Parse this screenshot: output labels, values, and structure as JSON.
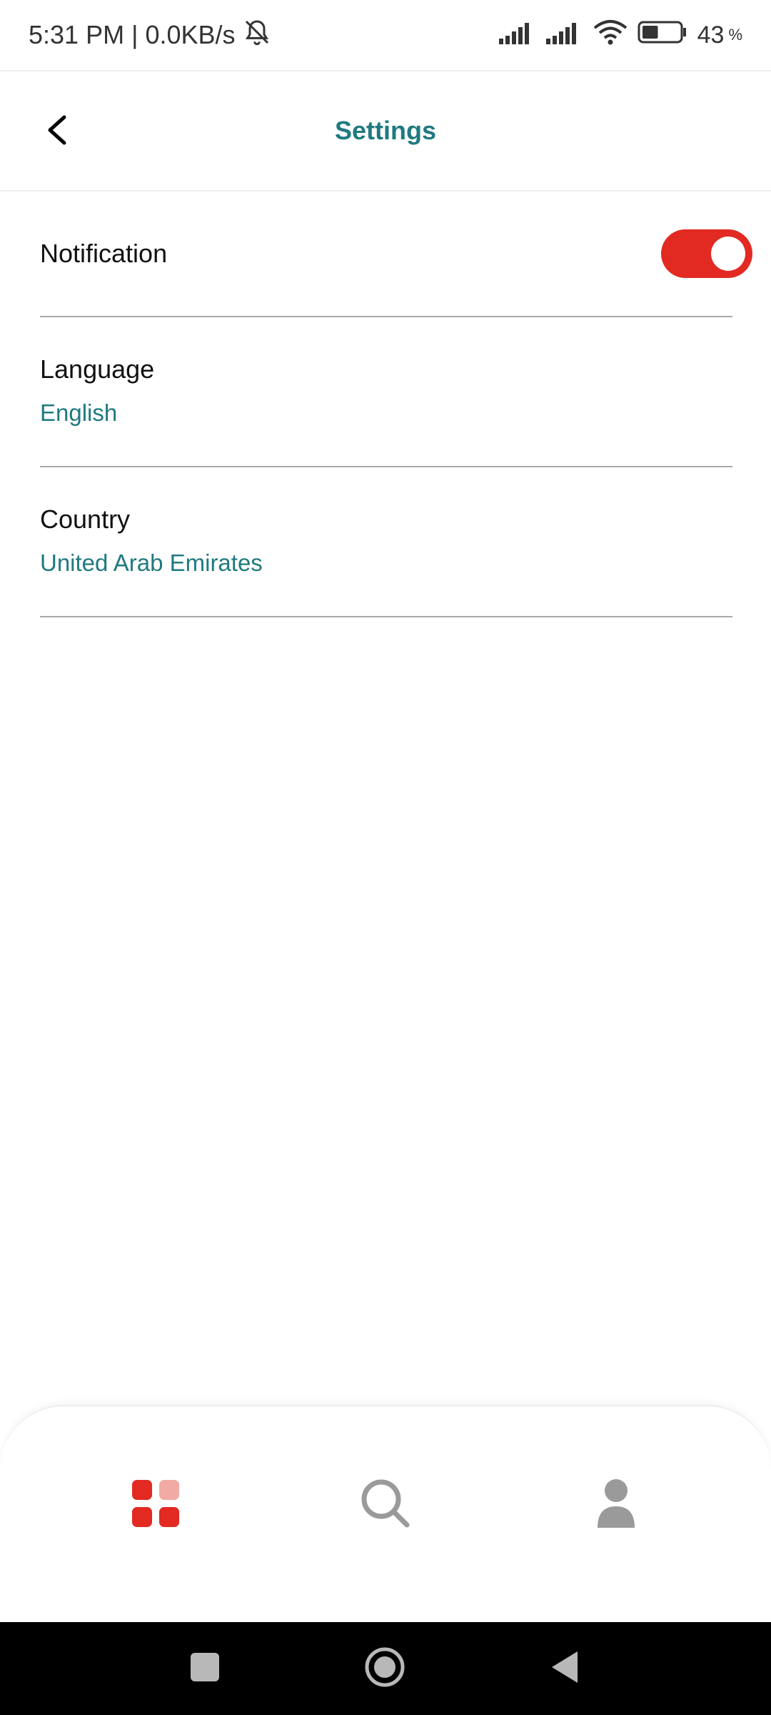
{
  "status_bar": {
    "time": "5:31 PM",
    "separator": "|",
    "network_speed": "0.0KB/s",
    "battery_percent": "43",
    "battery_unit": "%",
    "battery_level": 0.43
  },
  "header": {
    "title": "Settings"
  },
  "settings": {
    "notification": {
      "label": "Notification",
      "enabled": true
    },
    "language": {
      "label": "Language",
      "value": "English"
    },
    "country": {
      "label": "Country",
      "value": "United Arab Emirates"
    }
  },
  "bottom_nav": {
    "items": [
      {
        "icon": "grid-icon",
        "active": true
      },
      {
        "icon": "search-icon",
        "active": false
      },
      {
        "icon": "profile-icon",
        "active": false
      }
    ]
  },
  "colors": {
    "accent_teal": "#1f7a80",
    "toggle_red": "#e22a22",
    "active_icon_red": "#e22a22",
    "active_icon_light": "#f2aaa4",
    "inactive_icon_gray": "#9a9a9a",
    "divider": "#a9a9a9"
  }
}
